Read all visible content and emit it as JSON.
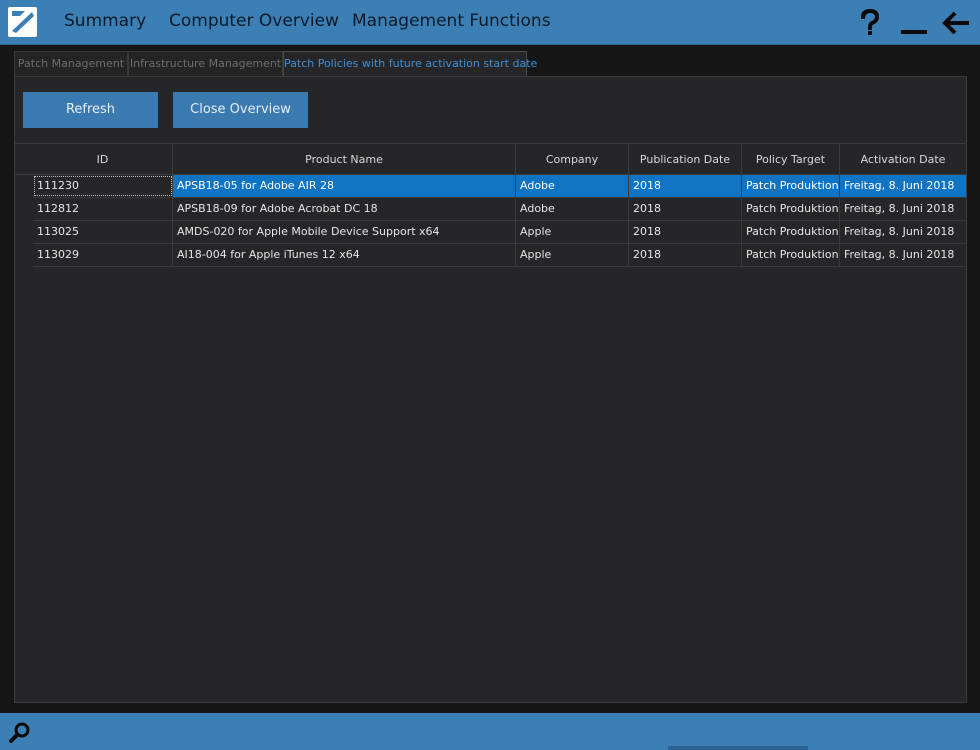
{
  "nav": {
    "items": [
      {
        "label": "Summary"
      },
      {
        "label": "Computer Overview"
      },
      {
        "label": "Management Functions"
      }
    ],
    "icons": [
      "help-icon",
      "minimize-icon",
      "back-arrow-icon"
    ]
  },
  "tabs": [
    {
      "label": "Patch Management",
      "active": false
    },
    {
      "label": "Infrastructure Management",
      "active": false
    },
    {
      "label": "Patch Policies with future activation start date",
      "active": true
    }
  ],
  "toolbar": {
    "refresh_label": "Refresh",
    "close_label": "Close Overview"
  },
  "table": {
    "columns": [
      "ID",
      "Product Name",
      "Company",
      "Publication Date",
      "Policy Target",
      "Activation Date"
    ],
    "rows": [
      {
        "id": "111230",
        "product": "APSB18-05 for Adobe AIR 28",
        "company": "Adobe",
        "publication": "2018",
        "target": "Patch Produktion",
        "activation": "Freitag, 8. Juni 2018"
      },
      {
        "id": "112812",
        "product": "APSB18-09 for Adobe Acrobat DC 18",
        "company": "Adobe",
        "publication": "2018",
        "target": "Patch Produktion",
        "activation": "Freitag, 8. Juni 2018"
      },
      {
        "id": "113025",
        "product": "AMDS-020 for Apple Mobile Device Support x64",
        "company": "Apple",
        "publication": "2018",
        "target": "Patch Produktion",
        "activation": "Freitag, 8. Juni 2018"
      },
      {
        "id": "113029",
        "product": "AI18-004 for Apple iTunes 12 x64",
        "company": "Apple",
        "publication": "2018",
        "target": "Patch Produktion",
        "activation": "Freitag, 8. Juni 2018"
      }
    ],
    "selected_row": 0
  },
  "colors": {
    "accent": "#3c7fb4",
    "selection": "#0f74c4",
    "active_tab": "#3d8fd6",
    "background": "#262628"
  }
}
